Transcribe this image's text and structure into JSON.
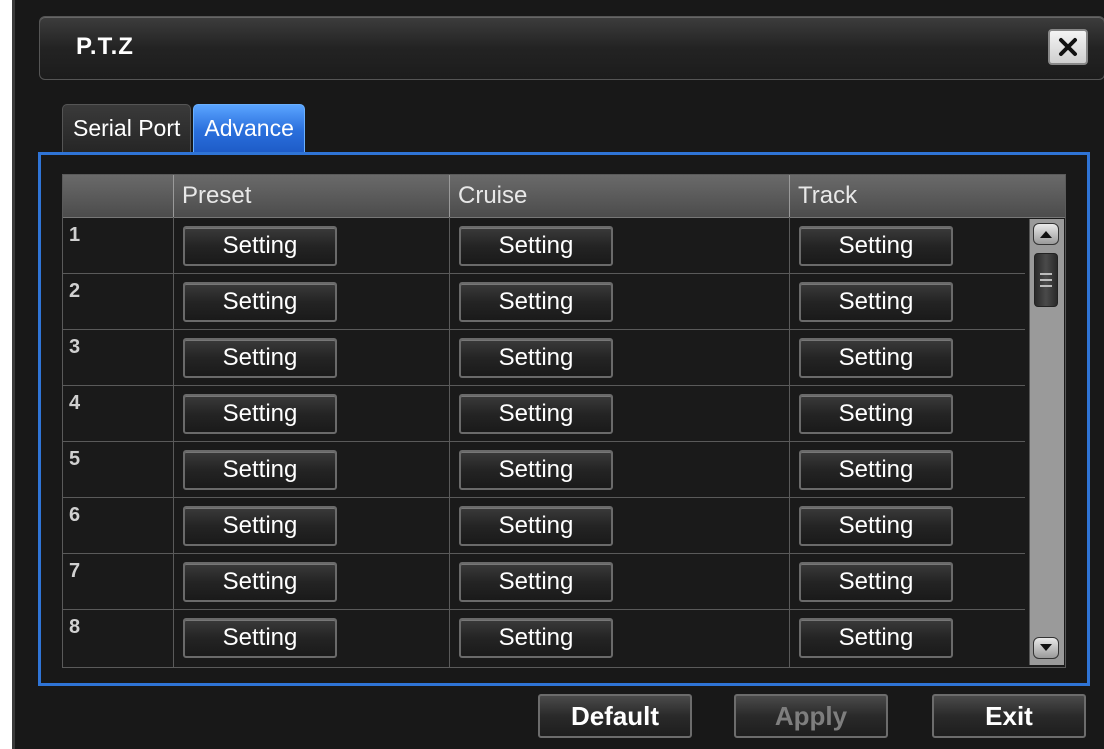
{
  "window": {
    "title": "P.T.Z"
  },
  "tabs": [
    {
      "label": "Serial Port",
      "active": false
    },
    {
      "label": "Advance",
      "active": true
    }
  ],
  "table": {
    "headers": [
      "",
      "Preset",
      "Cruise",
      "Track"
    ],
    "rows": [
      {
        "num": "1",
        "preset": "Setting",
        "cruise": "Setting",
        "track": "Setting"
      },
      {
        "num": "2",
        "preset": "Setting",
        "cruise": "Setting",
        "track": "Setting"
      },
      {
        "num": "3",
        "preset": "Setting",
        "cruise": "Setting",
        "track": "Setting"
      },
      {
        "num": "4",
        "preset": "Setting",
        "cruise": "Setting",
        "track": "Setting"
      },
      {
        "num": "5",
        "preset": "Setting",
        "cruise": "Setting",
        "track": "Setting"
      },
      {
        "num": "6",
        "preset": "Setting",
        "cruise": "Setting",
        "track": "Setting"
      },
      {
        "num": "7",
        "preset": "Setting",
        "cruise": "Setting",
        "track": "Setting"
      },
      {
        "num": "8",
        "preset": "Setting",
        "cruise": "Setting",
        "track": "Setting"
      }
    ]
  },
  "footer": {
    "default_label": "Default",
    "apply_label": "Apply",
    "exit_label": "Exit"
  },
  "icons": {
    "close": "close-icon",
    "scroll_up": "chevron-up-icon",
    "scroll_down": "chevron-down-icon",
    "scroll_thumb": "grip-icon"
  },
  "colors": {
    "accent": "#2f74d6",
    "active_tab": "#2a6fdc",
    "background": "#181818"
  }
}
